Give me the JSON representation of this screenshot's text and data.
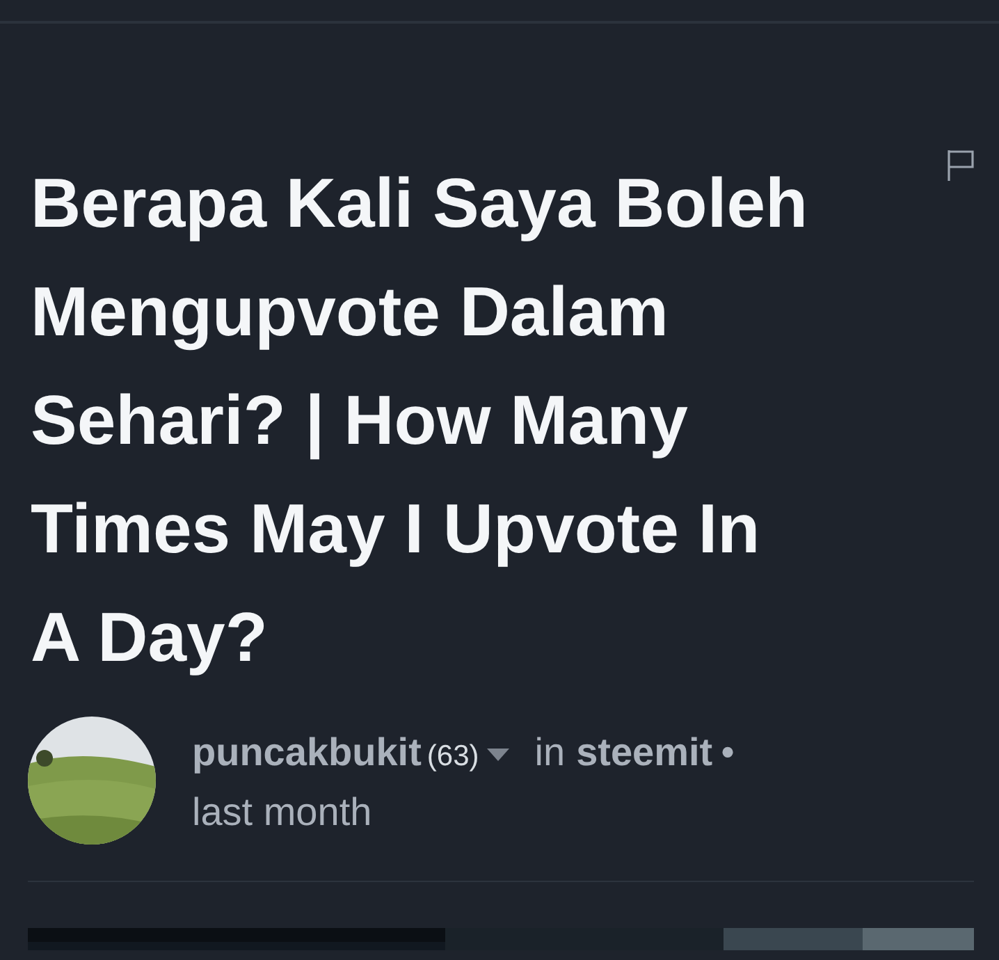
{
  "post": {
    "title": "Berapa Kali Saya Boleh Mengupvote Dalam Sehari? | How Many Times May I Upvote In A Day?",
    "author": "puncakbukit",
    "reputation": "(63)",
    "in_label": "in",
    "community": "steemit",
    "bullet": "•",
    "time": "last month"
  }
}
